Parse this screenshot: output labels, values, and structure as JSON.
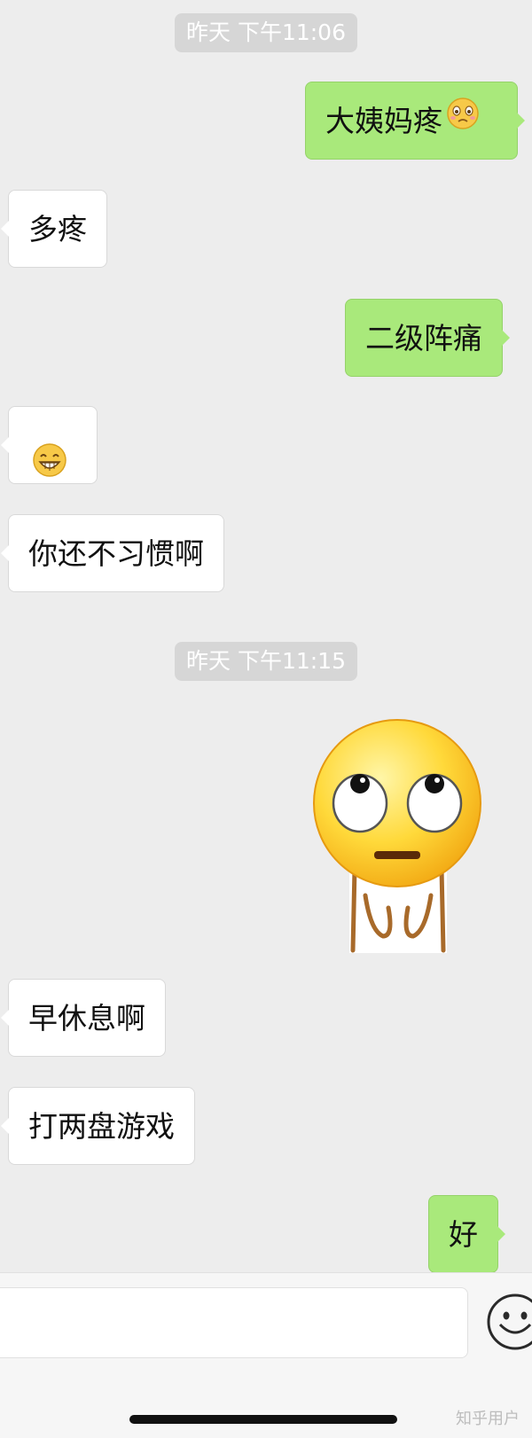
{
  "timestamps": {
    "first": "昨天 下午11:06",
    "second": "昨天 下午11:15"
  },
  "messages": [
    {
      "side": "out",
      "text": "大姨妈疼",
      "emoji": "woozy-face-emoji"
    },
    {
      "side": "in",
      "text": "多疼"
    },
    {
      "side": "out",
      "text": "二级阵痛"
    },
    {
      "side": "in",
      "text": "",
      "emoji": "grinning-face-emoji"
    },
    {
      "side": "in",
      "text": "你还不习惯啊"
    },
    {
      "side": "out",
      "text": "",
      "sticker": "eye-roll-sticker"
    },
    {
      "side": "in",
      "text": "早休息啊"
    },
    {
      "side": "in",
      "text": "打两盘游戏"
    },
    {
      "side": "out",
      "text": "好"
    }
  ],
  "input_bar": {
    "value": "",
    "emoji_button_icon": "smiley-face-icon"
  },
  "watermark": "知乎用户",
  "colors": {
    "background": "#ededed",
    "outgoing_bubble": "#a9e97b",
    "incoming_bubble": "#ffffff",
    "timestamp_bg": "#d6d6d6"
  }
}
